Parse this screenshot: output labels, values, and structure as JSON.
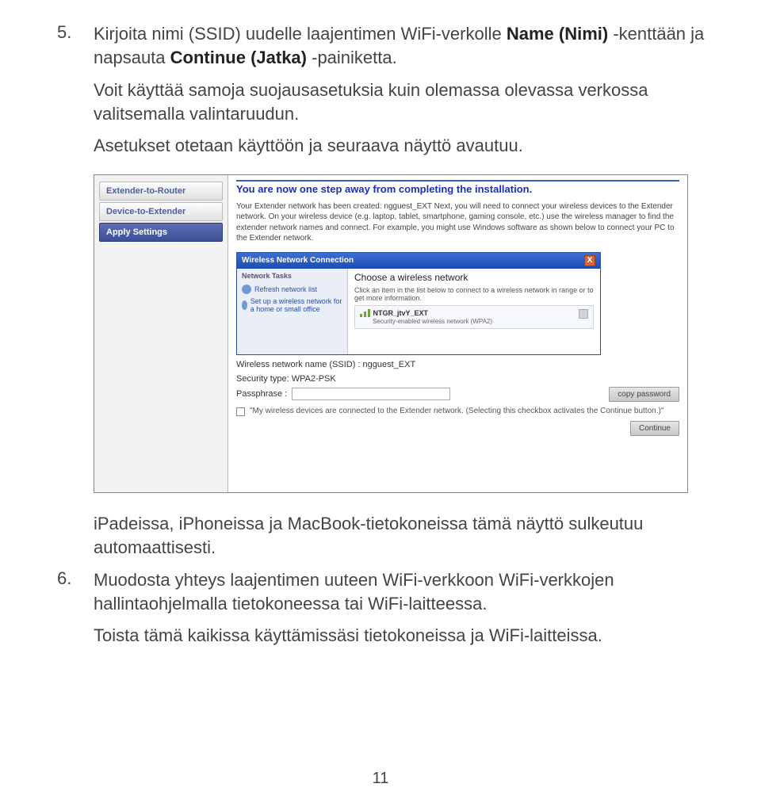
{
  "step5": {
    "num": "5.",
    "text_before": "Kirjoita nimi (SSID) uudelle laajentimen WiFi-verkolle ",
    "bold1": "Name (Nimi)",
    "text_mid": " -kenttään ja napsauta ",
    "bold2": "Continue (Jatka)",
    "text_after": " -painiketta.",
    "p2": "Voit käyttää samoja suojausasetuksia kuin olemassa olevassa verkossa valitsemalla valintaruudun.",
    "p3": "Asetukset otetaan käyttöön ja seuraava näyttö avautuu."
  },
  "shot": {
    "nav": {
      "item1": "Extender-to-Router",
      "item2": "Device-to-Extender",
      "item3": "Apply Settings"
    },
    "headline": "You are now one step away from completing the installation.",
    "descr": "Your Extender network has been created: ngguest_EXT Next, you will need to connect your wireless devices to the Extender network. On your wireless device (e.g. laptop, tablet, smartphone, gaming console, etc.) use the wireless manager to find the extender network names and connect. For example, you might use Windows software as shown below to connect your PC to the Extender network.",
    "xp": {
      "title": "Wireless Network Connection",
      "close": "X",
      "left_hdr": "Network Tasks",
      "left_link1": "Refresh network list",
      "left_link2": "Set up a wireless network for a home or small office",
      "cw": "Choose a wireless network",
      "instr": "Click an item in the list below to connect to a wireless network in range or to get more information.",
      "ssid": "NTGR_jtvY_EXT",
      "sec": "Security-enabled wireless network (WPA2)"
    },
    "ssid_lbl": "Wireless network name (SSID) : ngguest_EXT",
    "sectype_lbl": "Security type: WPA2-PSK",
    "passphrase_lbl": "Passphrase :",
    "copy_btn": "copy password",
    "chk_text": "\"My wireless devices are connected to the Extender network. (Selecting this checkbox activates the Continue button.)\"",
    "continue_btn": "Continue"
  },
  "post_shot": "iPadeissa, iPhoneissa ja MacBook-tietokoneissa tämä näyttö sulkeutuu automaattisesti.",
  "step6": {
    "num": "6.",
    "p1": "Muodosta yhteys laajentimen uuteen WiFi-verkkoon WiFi-verkkojen hallintaohjelmalla tietokoneessa tai WiFi-laitteessa.",
    "p2": "Toista tämä kaikissa käyttämissäsi tietokoneissa ja WiFi-laitteissa."
  },
  "page_num": "11"
}
